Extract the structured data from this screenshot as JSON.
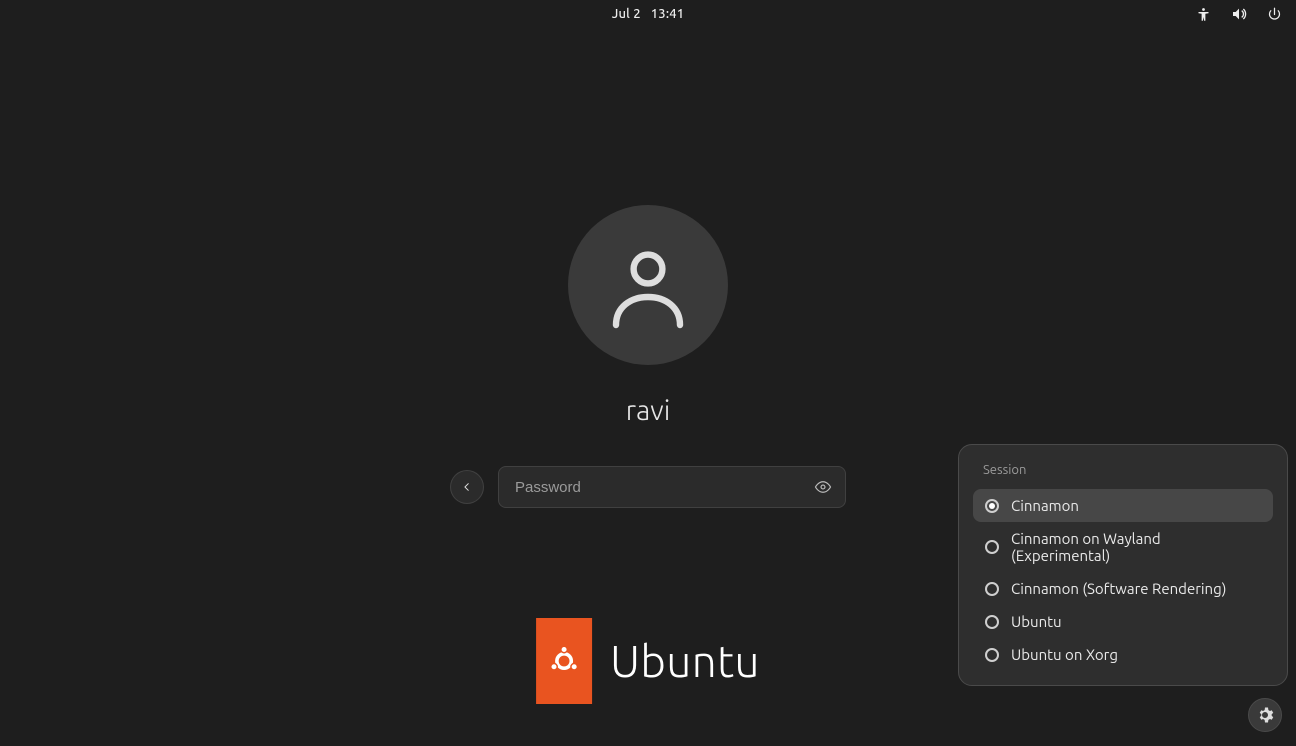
{
  "topbar": {
    "date": "Jul 2",
    "time": "13:41"
  },
  "login": {
    "username": "ravi",
    "password_placeholder": "Password",
    "password_value": ""
  },
  "brand": {
    "name": "Ubuntu"
  },
  "session": {
    "heading": "Session",
    "selected_index": 0,
    "options": [
      "Cinnamon",
      "Cinnamon on Wayland (Experimental)",
      "Cinnamon (Software Rendering)",
      "Ubuntu",
      "Ubuntu on Xorg"
    ]
  }
}
